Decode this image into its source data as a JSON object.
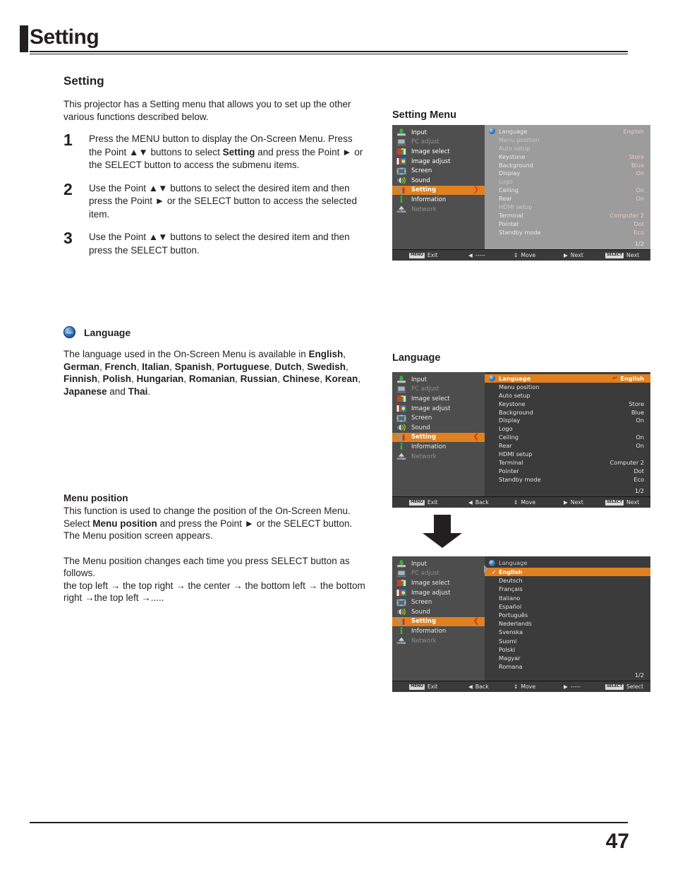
{
  "page": {
    "header_title": "Setting",
    "footer_page_number": "47"
  },
  "left": {
    "section_title": "Setting",
    "intro": "This projector has a Setting menu that allows you to set up the other various functions described below.",
    "steps": [
      {
        "num": "1",
        "text_parts": [
          "Press the MENU button to display the On-Screen Menu.  Press the Point ▲▼ buttons to select ",
          "Setting",
          " and press the Point ► or the SELECT button to access the submenu items."
        ]
      },
      {
        "num": "2",
        "text_parts": [
          "Use the Point ▲▼ buttons to select the desired item and then press the Point ► or the SELECT button to access the selected item.",
          "",
          ""
        ]
      },
      {
        "num": "3",
        "text_parts": [
          "Use the Point ▲▼ buttons to select the desired item and then press the SELECT button.",
          "",
          ""
        ]
      }
    ],
    "language_heading": "Language",
    "language_intro": "The language used in the On-Screen Menu is available in ",
    "language_list_bold": [
      "English",
      "German",
      "French",
      "Italian",
      "Spanish",
      "Portuguese",
      "Dutch",
      "Swedish",
      "Finnish",
      "Polish",
      "Hungarian",
      "Romanian",
      "Russian",
      "Chinese",
      "Korean",
      "Japanese"
    ],
    "language_last_join": " and ",
    "language_last": "Thai",
    "menu_position_heading": "Menu position",
    "menu_position_p1_a": "This function is used to change the position of the On-Screen Menu. Select ",
    "menu_position_p1_b": "Menu position",
    "menu_position_p1_c": " and press the Point ► or the SELECT button. The Menu position screen appears.",
    "menu_position_p2": "The Menu position changes each time you press SELECT button as follows.",
    "menu_position_p3": "the top left  → the top right  → the center → the bottom left → the bottom right  →the top left  →.....",
    "arrow_glyph": "→"
  },
  "osd_labels": {
    "setting_menu": "Setting Menu",
    "language": "Language"
  },
  "sidebar": {
    "items": [
      {
        "label": "Input",
        "icon": "input-icon",
        "state": "normal"
      },
      {
        "label": "PC adjust",
        "icon": "pc-adjust-icon",
        "state": "dim"
      },
      {
        "label": "Image select",
        "icon": "image-select-icon",
        "state": "normal"
      },
      {
        "label": "Image adjust",
        "icon": "image-adjust-icon",
        "state": "normal"
      },
      {
        "label": "Screen",
        "icon": "screen-icon",
        "state": "normal"
      },
      {
        "label": "Sound",
        "icon": "sound-icon",
        "state": "normal"
      },
      {
        "label": "Setting",
        "icon": "setting-icon",
        "state": "active"
      },
      {
        "label": "Information",
        "icon": "information-icon",
        "state": "normal"
      },
      {
        "label": "Network",
        "icon": "network-icon",
        "state": "dim"
      }
    ],
    "caret_right": "❯",
    "caret_left": "❮"
  },
  "setting_options": {
    "rows": [
      {
        "label": "Language",
        "value": "English"
      },
      {
        "label": "Menu position",
        "value": ""
      },
      {
        "label": "Auto setup",
        "value": ""
      },
      {
        "label": "Keystone",
        "value": "Store"
      },
      {
        "label": "Background",
        "value": "Blue"
      },
      {
        "label": "Display",
        "value": "On"
      },
      {
        "label": "Logo",
        "value": ""
      },
      {
        "label": "Ceiling",
        "value": "On"
      },
      {
        "label": "Rear",
        "value": "On"
      },
      {
        "label": "HDMI setup",
        "value": ""
      },
      {
        "label": "Terminal",
        "value": "Computer 2"
      },
      {
        "label": "Pointer",
        "value": "Dot"
      },
      {
        "label": "Standby mode",
        "value": "Eco"
      }
    ],
    "page_indicator": "1/2",
    "select_mark": "↵"
  },
  "language_options": {
    "header": "Language",
    "items": [
      "English",
      "Deutsch",
      "Français",
      "Italiano",
      "Español",
      "Português",
      "Nederlands",
      "Svenska",
      "Suomi",
      "Polski",
      "Magyar",
      "Romana"
    ],
    "selected": "English",
    "tick": "✓",
    "page_indicator": "1/2"
  },
  "osd_bars": {
    "bar1": [
      {
        "chip": "MENU",
        "glyph": "",
        "label": "Exit"
      },
      {
        "chip": "",
        "glyph": "◀",
        "label": "-----"
      },
      {
        "chip": "",
        "glyph": "↕",
        "label": "Move"
      },
      {
        "chip": "",
        "glyph": "▶",
        "label": "Next"
      },
      {
        "chip": "SELECT",
        "glyph": "",
        "label": "Next"
      }
    ],
    "bar2": [
      {
        "chip": "MENU",
        "glyph": "",
        "label": "Exit"
      },
      {
        "chip": "",
        "glyph": "◀",
        "label": "Back"
      },
      {
        "chip": "",
        "glyph": "↕",
        "label": "Move"
      },
      {
        "chip": "",
        "glyph": "▶",
        "label": "Next"
      },
      {
        "chip": "SELECT",
        "glyph": "",
        "label": "Next"
      }
    ],
    "bar3": [
      {
        "chip": "MENU",
        "glyph": "",
        "label": "Exit"
      },
      {
        "chip": "",
        "glyph": "◀",
        "label": "Back"
      },
      {
        "chip": "",
        "glyph": "↕",
        "label": "Move"
      },
      {
        "chip": "",
        "glyph": "▶",
        "label": "-----"
      },
      {
        "chip": "SELECT",
        "glyph": "",
        "label": "Select"
      }
    ]
  },
  "colors": {
    "accent_orange": "#e0801f",
    "caret_red": "#e83b22",
    "ink": "#231f20",
    "osd_dark": "#3b3b3b",
    "osd_side": "#4d4d4d",
    "osd_right_faded": "#9c9c9c"
  }
}
